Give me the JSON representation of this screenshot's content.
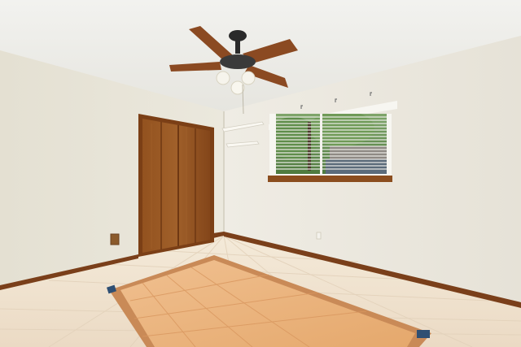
{
  "scene": {
    "type": "photo",
    "subject": "empty-bedroom-interior"
  },
  "elements": {
    "ceiling": "ceiling",
    "ceiling_fan": "ceiling-fan",
    "closet": "closet-doors",
    "window": "window-with-blinds",
    "shelves": "corner-shelves",
    "floor": "tile-floor",
    "outlet": "wall-outlet"
  },
  "colors": {
    "ceiling": "#eeeeea",
    "wall_left": "#e7e3d6",
    "wall_right": "#ebe8df",
    "wood": "#8b4d1e",
    "baseboard": "#7a3f1a",
    "tile": "#efdcc5",
    "tile_inlay": "#e8b27a",
    "tile_border": "#c98a57"
  }
}
